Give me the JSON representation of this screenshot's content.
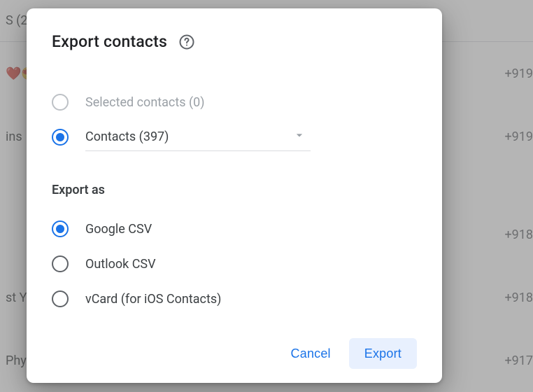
{
  "dialog": {
    "title": "Export contacts",
    "source": {
      "selected_contacts_label": "Selected contacts (0)",
      "contacts_label": "Contacts (397)",
      "selected_value": "contacts"
    },
    "export_as": {
      "section_label": "Export as",
      "options": {
        "google_csv": "Google CSV",
        "outlook_csv": "Outlook CSV",
        "vcard": "vCard (for iOS Contacts)"
      },
      "selected_value": "google_csv"
    },
    "buttons": {
      "cancel": "Cancel",
      "export": "Export"
    }
  },
  "background": {
    "rows": [
      {
        "left": "S (2",
        "right": ""
      },
      {
        "left": "❤️😍",
        "right": "+919"
      },
      {
        "left": "ins",
        "right": "+919"
      },
      {
        "left": "",
        "right": ""
      },
      {
        "left": "",
        "right": "+918"
      },
      {
        "left": "st Yr",
        "right": "+918"
      },
      {
        "left": "Phys",
        "right": "+917"
      }
    ]
  },
  "icons": {
    "help": "help-icon",
    "chevron_down": "chevron-down-icon"
  }
}
